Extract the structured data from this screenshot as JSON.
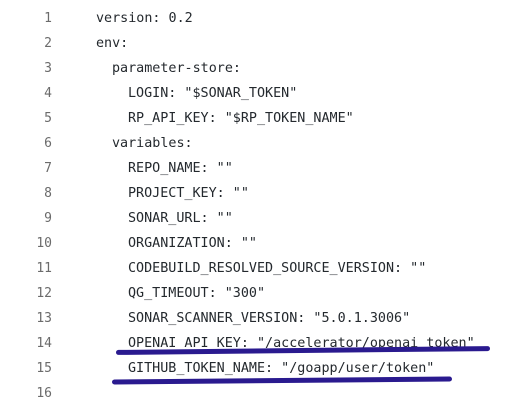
{
  "lines": [
    {
      "num": "1",
      "text": "version: 0.2"
    },
    {
      "num": "2",
      "text": "env:"
    },
    {
      "num": "3",
      "text": "parameter-store:"
    },
    {
      "num": "4",
      "text": "LOGIN: \"$SONAR_TOKEN\""
    },
    {
      "num": "5",
      "text": "RP_API_KEY: \"$RP_TOKEN_NAME\""
    },
    {
      "num": "6",
      "text": "variables:"
    },
    {
      "num": "7",
      "text": "REPO_NAME: \"\""
    },
    {
      "num": "8",
      "text": "PROJECT_KEY: \"\""
    },
    {
      "num": "9",
      "text": "SONAR_URL: \"\""
    },
    {
      "num": "10",
      "text": "ORGANIZATION: \"\""
    },
    {
      "num": "11",
      "text": "CODEBUILD_RESOLVED_SOURCE_VERSION: \"\""
    },
    {
      "num": "12",
      "text": "QG_TIMEOUT: \"300\""
    },
    {
      "num": "13",
      "text": "SONAR_SCANNER_VERSION: \"5.0.1.3006\""
    },
    {
      "num": "14",
      "text": "OPENAI_API_KEY: \"/accelerator/openai_token\""
    },
    {
      "num": "15",
      "text": "GITHUB_TOKEN_NAME: \"/goapp/user/token\""
    },
    {
      "num": "16",
      "text": ""
    }
  ],
  "colors": {
    "text": "#24292e",
    "line_number": "#6b6b6b",
    "annotation_underline": "#2a1a8f"
  }
}
